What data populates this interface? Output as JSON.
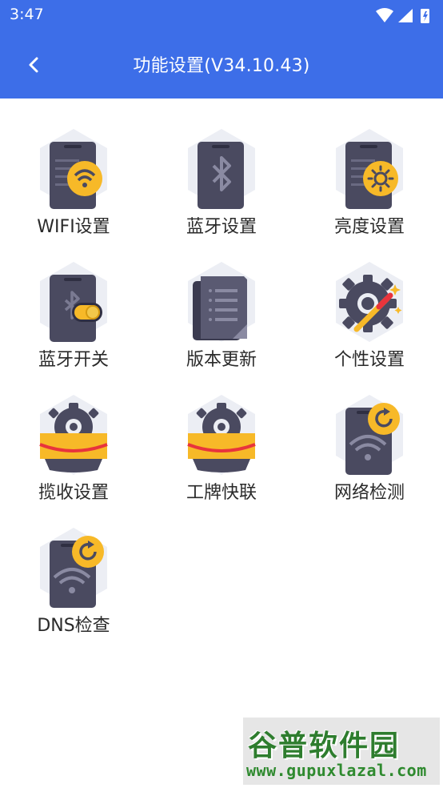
{
  "status_bar": {
    "time": "3:47"
  },
  "app_bar": {
    "title": "功能设置(V34.10.43)"
  },
  "items": [
    {
      "label": "WIFI设置",
      "icon": "wifi-settings-icon"
    },
    {
      "label": "蓝牙设置",
      "icon": "bluetooth-settings-icon"
    },
    {
      "label": "亮度设置",
      "icon": "brightness-settings-icon"
    },
    {
      "label": "蓝牙开关",
      "icon": "bluetooth-toggle-icon"
    },
    {
      "label": "版本更新",
      "icon": "version-update-icon"
    },
    {
      "label": "个性设置",
      "icon": "personalization-icon"
    },
    {
      "label": "揽收设置",
      "icon": "pickup-settings-icon"
    },
    {
      "label": "工牌快联",
      "icon": "badge-quick-connect-icon"
    },
    {
      "label": "网络检测",
      "icon": "network-check-icon"
    },
    {
      "label": "DNS检查",
      "icon": "dns-check-icon"
    }
  ],
  "watermark": {
    "brand": "谷普软件园",
    "url": "www.gupuxlazal.com"
  },
  "colors": {
    "app_bar": "#3d6ee8",
    "device": "#4a4a60",
    "badge": "#f7b928",
    "hexagon": "#eceef4"
  }
}
